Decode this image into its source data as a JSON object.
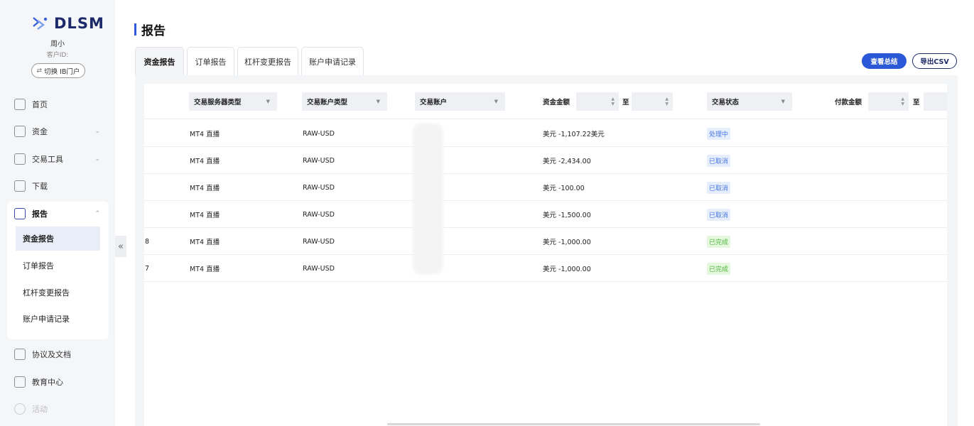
{
  "brand": {
    "logo_text": "DLSM",
    "accent": "#2f5bd8",
    "logo_color": "#1c2a6b"
  },
  "user": {
    "name": "周小",
    "id_label": "客户ID:",
    "switch_label": "切换 IB门户"
  },
  "sidebar": {
    "items": [
      {
        "label": "首页",
        "icon": "home-icon"
      },
      {
        "label": "资金",
        "icon": "wallet-icon",
        "has_chevron": true
      },
      {
        "label": "交易工具",
        "icon": "tools-icon",
        "has_chevron": true
      },
      {
        "label": "下载",
        "icon": "download-icon"
      }
    ],
    "report_group": {
      "label": "报告",
      "icon": "report-icon",
      "sub_items": [
        "资金报告",
        "订单报告",
        "杠杆变更报告",
        "账户申请记录"
      ]
    },
    "bottom_items": [
      {
        "label": "协议及文档",
        "icon": "document-icon"
      },
      {
        "label": "教育中心",
        "icon": "education-icon"
      },
      {
        "label": "活动",
        "icon": "activity-icon"
      }
    ],
    "collapse_glyph": "«"
  },
  "page": {
    "title": "报告"
  },
  "tabs": [
    "资金报告",
    "订单报告",
    "杠杆变更报告",
    "账户申请记录"
  ],
  "actions": {
    "summary": "查看总结",
    "export_csv": "导出CSV"
  },
  "table": {
    "filters": {
      "server_type": "交易服务器类型",
      "account_type": "交易账户类型",
      "account": "交易账户",
      "amount": "资金金额",
      "to": "至",
      "status": "交易状态",
      "payment_amount": "付款金额",
      "to2": "至"
    },
    "rows": [
      {
        "id": "",
        "server": "MT4 直播",
        "type": "RAW-USD",
        "amount": "美元 -1,107.22美元",
        "status": "处理中",
        "status_color": "blue"
      },
      {
        "id": "",
        "server": "MT4 直播",
        "type": "RAW-USD",
        "amount": "美元 -2,434.00",
        "status": "已取消",
        "status_color": "blue"
      },
      {
        "id": "",
        "server": "MT4 直播",
        "type": "RAW-USD",
        "amount": "美元 -100.00",
        "status": "已取消",
        "status_color": "blue"
      },
      {
        "id": "",
        "server": "MT4 直播",
        "type": "RAW-USD",
        "amount": "美元 -1,500.00",
        "status": "已取消",
        "status_color": "blue"
      },
      {
        "id": "8",
        "server": "MT4 直播",
        "type": "RAW-USD",
        "amount": "美元 -1,000.00",
        "status": "已完成",
        "status_color": "green"
      },
      {
        "id": "7",
        "server": "MT4 直播",
        "type": "RAW-USD",
        "amount": "美元 -1,000.00",
        "status": "已完成",
        "status_color": "green"
      }
    ]
  }
}
